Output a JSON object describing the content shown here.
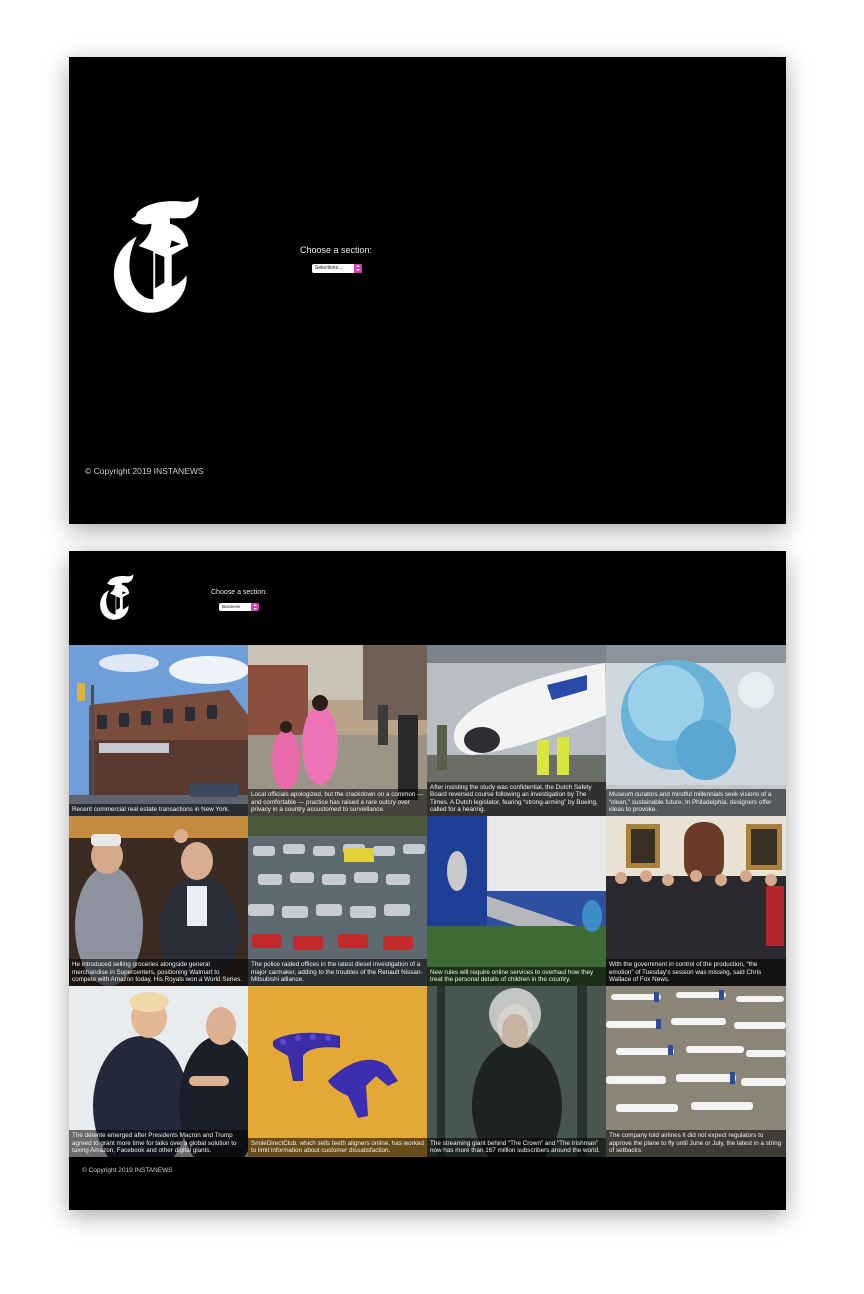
{
  "home": {
    "section_label": "Choose a section:",
    "select_value": "Selections...",
    "copyright": "© Copyright 2019 INSTANEWS"
  },
  "results": {
    "section_label": "Choose a section:",
    "select_value": "Business",
    "copyright": "© Copyright 2019 INSTANEWS",
    "articles": [
      {
        "caption": "Recent commercial real estate transactions in New York."
      },
      {
        "caption": "Local officials apologized, but the crackdown on a common — and comfortable — practice has raised a rare outcry over privacy in a country accustomed to surveillance."
      },
      {
        "caption": "After insisting the study was confidential, the Dutch Safety Board reversed course following an investigation by The Times. A Dutch legislator, fearing “strong-arming” by Boeing, called for a hearing."
      },
      {
        "caption": "Museum curators and mindful millennials seek visions of a “clean,” sustainable future. In Philadelphia, designers offer ideas to provoke."
      },
      {
        "caption": "He introduced selling groceries alongside general merchandise in Supercenters, positioning Walmart to compete with Amazon today. His Royals won a World Series."
      },
      {
        "caption": "The police raided offices in the latest diesel investigation of a major carmaker, adding to the troubles of the Renault Nissan-Mitsubishi alliance."
      },
      {
        "caption": "New rules will require online services to overhaul how they treat the personal details of children in the country."
      },
      {
        "caption": "With the government in control of the production, “the emotion” of Tuesday’s session was missing, said Chris Wallace of Fox News."
      },
      {
        "caption": "The détente emerged after Presidents Macron and Trump agreed to grant more time for talks over a global solution to taxing Amazon, Facebook and other digital giants."
      },
      {
        "caption": "SmileDirectClub, which sells teeth aligners online, has worked to limit information about customer dissatisfaction."
      },
      {
        "caption": "The streaming giant behind “The Crown” and “The Irishman” now has more than 167 million subscribers around the world."
      },
      {
        "caption": "The company told airlines it did not expect regulators to approve the plane to fly until June or July, the latest in a string of setbacks."
      }
    ]
  }
}
